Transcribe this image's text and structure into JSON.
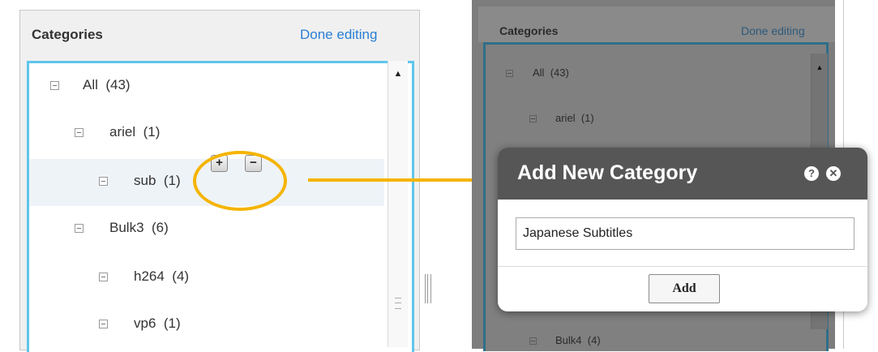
{
  "left_panel": {
    "title": "Categories",
    "done_link": "Done editing",
    "tree": [
      {
        "label": "All",
        "count": "(43)",
        "level": 0
      },
      {
        "label": "ariel",
        "count": "(1)",
        "level": 1
      },
      {
        "label": "sub",
        "count": "(1)",
        "level": 2,
        "selected": true
      },
      {
        "label": "Bulk3",
        "count": "(6)",
        "level": 1
      },
      {
        "label": "h264",
        "count": "(4)",
        "level": 2
      },
      {
        "label": "vp6",
        "count": "(1)",
        "level": 2
      }
    ],
    "add_button": "+",
    "remove_button": "−"
  },
  "right_panel": {
    "title": "Categories",
    "done_link": "Done editing",
    "tree": [
      {
        "label": "All",
        "count": "(43)"
      },
      {
        "label": "ariel",
        "count": "(1)"
      },
      {
        "label": "Bulk4",
        "count": "(4)"
      }
    ]
  },
  "dialog": {
    "title": "Add New Category",
    "help_icon": "?",
    "close_icon": "✕",
    "input_value": "Japanese Subtitles",
    "add_button": "Add"
  },
  "colors": {
    "link": "#2a7fd4",
    "tree_border": "#5ec6ec",
    "highlight": "#f5b400",
    "dialog_header": "#565656"
  }
}
